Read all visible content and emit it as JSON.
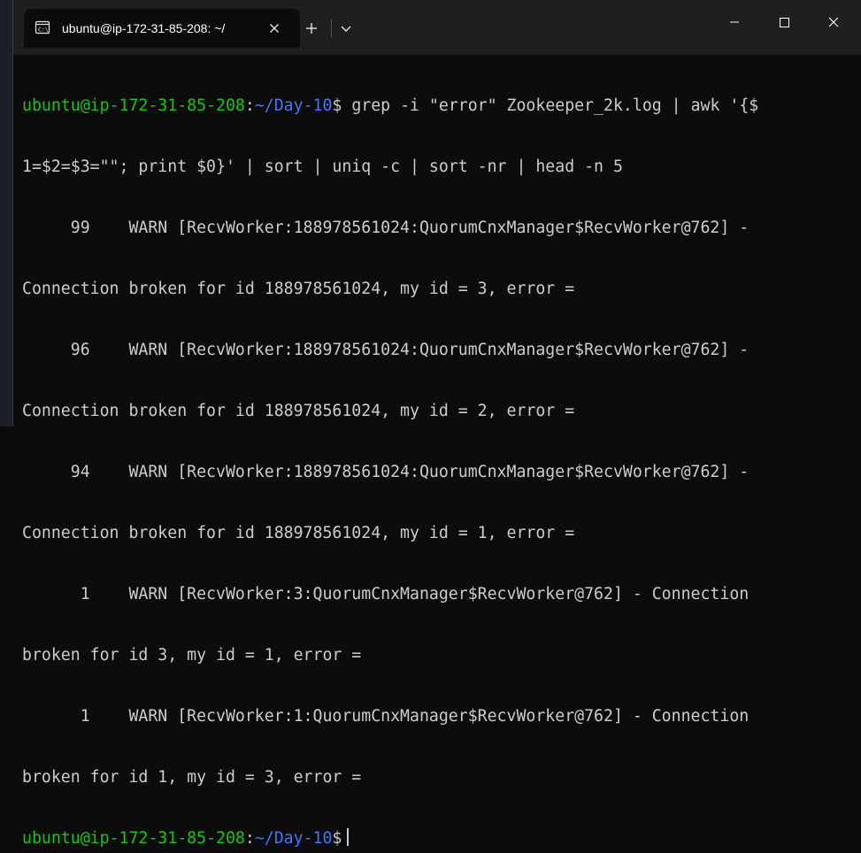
{
  "tab": {
    "title": "ubuntu@ip-172-31-85-208: ~/"
  },
  "icons": {
    "tab_icon": "terminal-icon",
    "close": "close-icon",
    "new_tab": "plus-icon",
    "dropdown": "chevron-down-icon",
    "minimize": "minimize-icon",
    "maximize": "maximize-icon",
    "window_close": "window-close-icon"
  },
  "colors": {
    "prompt_user": "#16c60c",
    "prompt_path": "#3b78ff",
    "text": "#cccccc",
    "background": "#0c0c0c",
    "titlebar": "#1f1f1f"
  },
  "prompt": {
    "user_host": "ubuntu@ip-172-31-85-208",
    "colon": ":",
    "path": "~/Day-10",
    "dollar": "$"
  },
  "command": {
    "line1": " grep -i \"error\" Zookeeper_2k.log | awk '{$",
    "line2": "1=$2=$3=\"\"; print $0}' | sort | uniq -c | sort -nr | head -n 5"
  },
  "output": [
    "     99    WARN [RecvWorker:188978561024:QuorumCnxManager$RecvWorker@762] -",
    "Connection broken for id 188978561024, my id = 3, error =",
    "     96    WARN [RecvWorker:188978561024:QuorumCnxManager$RecvWorker@762] -",
    "Connection broken for id 188978561024, my id = 2, error =",
    "     94    WARN [RecvWorker:188978561024:QuorumCnxManager$RecvWorker@762] -",
    "Connection broken for id 188978561024, my id = 1, error =",
    "      1    WARN [RecvWorker:3:QuorumCnxManager$RecvWorker@762] - Connection",
    "broken for id 3, my id = 1, error =",
    "      1    WARN [RecvWorker:1:QuorumCnxManager$RecvWorker@762] - Connection",
    "broken for id 1, my id = 3, error ="
  ]
}
